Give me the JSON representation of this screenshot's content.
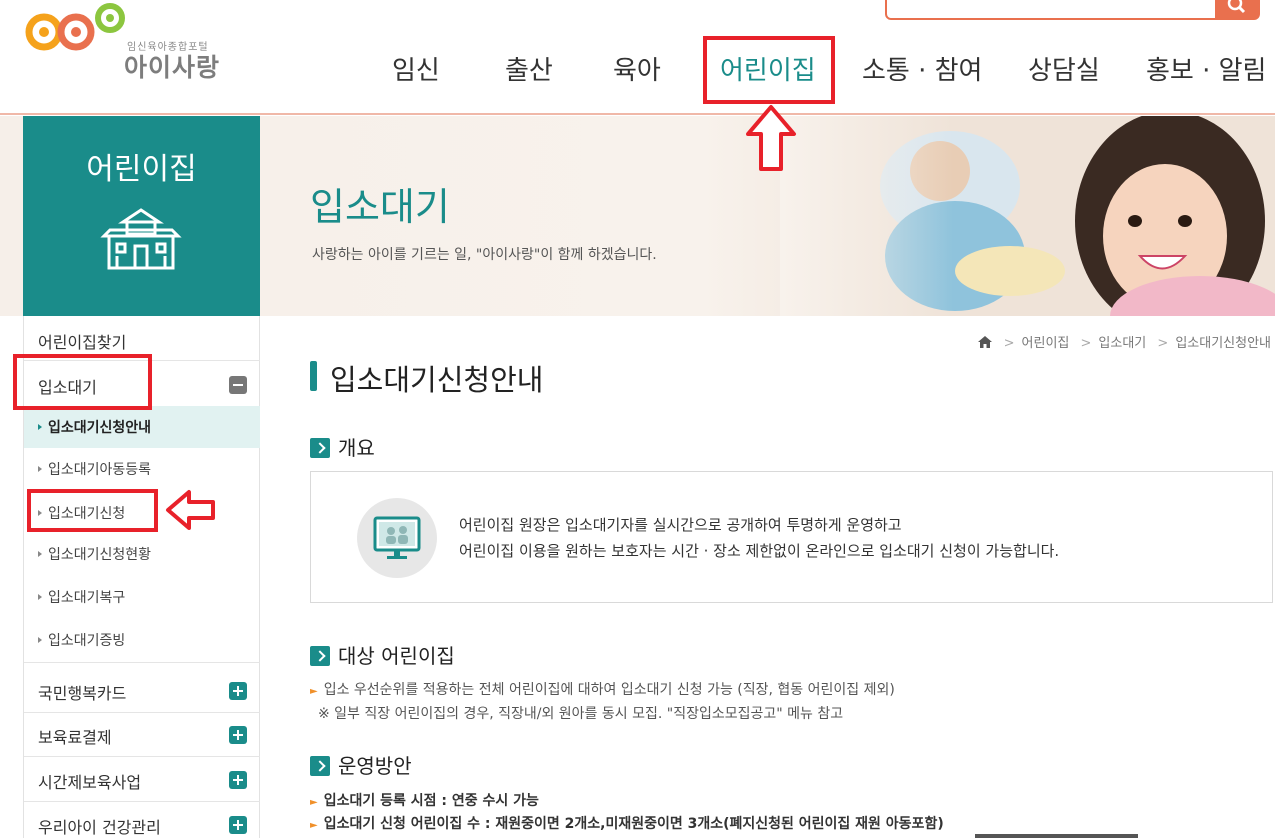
{
  "logo": {
    "sub": "임신육아종합포털",
    "main": "아이사랑"
  },
  "gnb": [
    {
      "label": "임신"
    },
    {
      "label": "출산"
    },
    {
      "label": "육아"
    },
    {
      "label": "어린이집"
    },
    {
      "label": "소통 · 참여"
    },
    {
      "label": "상담실"
    },
    {
      "label": "홍보 · 알림"
    }
  ],
  "banner": {
    "title": "입소대기",
    "subtitle": "사랑하는 아이를 기르는 일, \"아이사랑\"이 함께 하겠습니다."
  },
  "side_head": {
    "title": "어린이집"
  },
  "sidebar": {
    "menu": [
      {
        "label": "어린이집찾기"
      },
      {
        "label": "입소대기"
      },
      {
        "label": "국민행복카드"
      },
      {
        "label": "보육료결제"
      },
      {
        "label": "시간제보육사업"
      },
      {
        "label": "우리아이 건강관리"
      }
    ],
    "submenu": [
      {
        "label": "입소대기신청안내"
      },
      {
        "label": "입소대기아동등록"
      },
      {
        "label": "입소대기신청"
      },
      {
        "label": "입소대기신청현황"
      },
      {
        "label": "입소대기복구"
      },
      {
        "label": "입소대기증빙"
      }
    ]
  },
  "breadcrumb": [
    "어린이집",
    "입소대기",
    "입소대기신청안내"
  ],
  "content": {
    "page_title": "입소대기신청안내",
    "sec1": {
      "title": "개요",
      "line1": "어린이집 원장은 입소대기자를 실시간으로 공개하여 투명하게 운영하고",
      "line2": "어린이집 이용을 원하는 보호자는 시간 · 장소 제한없이 온라인으로 입소대기 신청이 가능합니다."
    },
    "sec2": {
      "title": "대상 어린이집",
      "line1": "입소 우선순위를 적용하는 전체 어린이집에 대하여 입소대기 신청 가능 (직장, 협동 어린이집 제외)",
      "note": "※ 일부 직장 어린이집의 경우, 직장내/외 원아를 동시 모집. \"직장입소모집공고\" 메뉴 참고"
    },
    "sec3": {
      "title": "운영방안",
      "line1": "입소대기 등록 시점 : 연중 수시 가능",
      "line2": "입소대기 신청 어린이집 수 : 재원중이면 2개소,미재원중이면 3개소(폐지신청된 어린이집 재원 아동포함)"
    }
  },
  "colors": {
    "brand": "#1a8c8a",
    "accent": "#e9704e",
    "highlight": "#e8212a"
  }
}
